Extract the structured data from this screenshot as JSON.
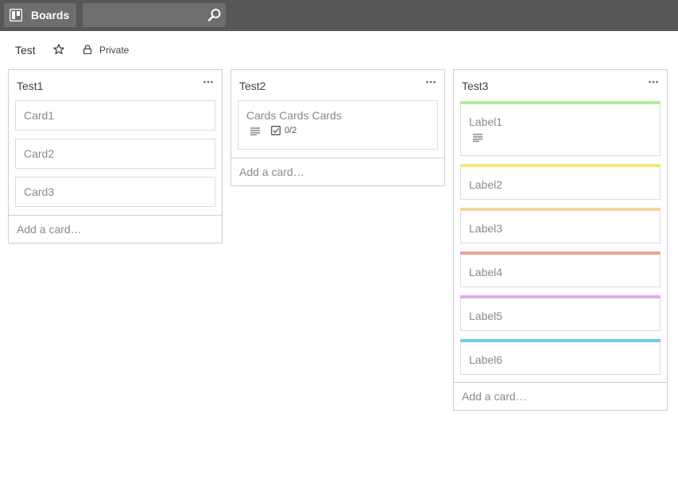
{
  "topbar": {
    "boards_label": "Boards",
    "boards_icon": "boards-icon",
    "search_value": "",
    "search_icon": "search-icon"
  },
  "board": {
    "title": "Test",
    "star_icon": "star-icon",
    "privacy_icon": "lock-icon",
    "privacy_label": "Private"
  },
  "lists": [
    {
      "title": "Test1",
      "add_card": "Add a card…",
      "cards": [
        {
          "title": "Card1"
        },
        {
          "title": "Card2"
        },
        {
          "title": "Card3"
        }
      ]
    },
    {
      "title": "Test2",
      "add_card": "Add a card…",
      "cards": [
        {
          "title": "Cards Cards Cards",
          "has_description": true,
          "checklist": "0/2"
        }
      ]
    },
    {
      "title": "Test3",
      "add_card": "Add a card…",
      "cards": [
        {
          "title": "Label1",
          "label_color": "#b3ec9e",
          "has_description": true
        },
        {
          "title": "Label2",
          "label_color": "#f2e77b"
        },
        {
          "title": "Label3",
          "label_color": "#f5d39b"
        },
        {
          "title": "Label4",
          "label_color": "#ef9f97"
        },
        {
          "title": "Label5",
          "label_color": "#e7a9ee"
        },
        {
          "title": "Label6",
          "label_color": "#6fcde8"
        }
      ]
    }
  ]
}
